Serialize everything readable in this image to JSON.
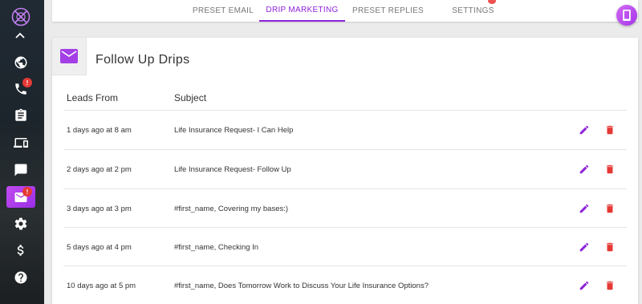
{
  "sidebar": {
    "items": [
      {
        "icon": "globe-icon"
      },
      {
        "icon": "phone-icon",
        "badge": "!"
      },
      {
        "icon": "clipboard-icon"
      },
      {
        "icon": "devices-icon"
      },
      {
        "icon": "chat-icon"
      },
      {
        "icon": "email-icon",
        "badge": "!",
        "active": true
      },
      {
        "icon": "gear-icon"
      },
      {
        "icon": "dollar-icon"
      },
      {
        "icon": "help-icon"
      }
    ]
  },
  "tabs": [
    {
      "label": "PRESET EMAIL"
    },
    {
      "label": "DRIP MARKETING",
      "active": true
    },
    {
      "label": "PRESET REPLIES"
    },
    {
      "label": "SETTINGS"
    }
  ],
  "card": {
    "title": "Follow Up Drips",
    "columns": {
      "leads_from": "Leads From",
      "subject": "Subject"
    },
    "rows": [
      {
        "leads_from": "1 days ago at 8 am",
        "subject": "Life Insurance Request- I Can Help"
      },
      {
        "leads_from": "2 days ago at 2 pm",
        "subject": "Life Insurance Request- Follow Up"
      },
      {
        "leads_from": "3 days ago at 3 pm",
        "subject": "#first_name, Covering my bases:)"
      },
      {
        "leads_from": "5 days ago at 4 pm",
        "subject": "#first_name, Checking In"
      },
      {
        "leads_from": "10 days ago at 5 pm",
        "subject": "#first_name, Does Tomorrow Work to Discuss Your Life Insurance Options?"
      }
    ]
  },
  "colors": {
    "accent": "#8e24d8",
    "delete": "#e53935",
    "sidebar": "#1f272e"
  }
}
